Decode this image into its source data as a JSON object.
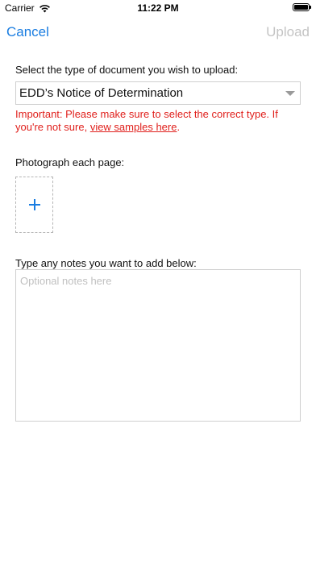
{
  "status_bar": {
    "carrier": "Carrier",
    "time": "11:22 PM",
    "battery_icon": "battery-full-icon",
    "wifi_icon": "wifi-icon"
  },
  "nav": {
    "cancel_label": "Cancel",
    "upload_label": "Upload"
  },
  "form": {
    "doc_type_label": "Select the type of document you wish to upload:",
    "doc_type_value": "EDD’s Notice of Determination",
    "warning_text": "Important: Please make sure to select the correct type. If you're not sure, ",
    "warning_link": "view samples here",
    "warning_end": ".",
    "photo_label": "Photograph each page:",
    "notes_label": "Type any notes you want to add below:",
    "notes_placeholder": "Optional notes here",
    "notes_value": ""
  },
  "colors": {
    "accent": "#1a7de1",
    "disabled": "#c4c4c4",
    "warning": "#e0201c"
  }
}
